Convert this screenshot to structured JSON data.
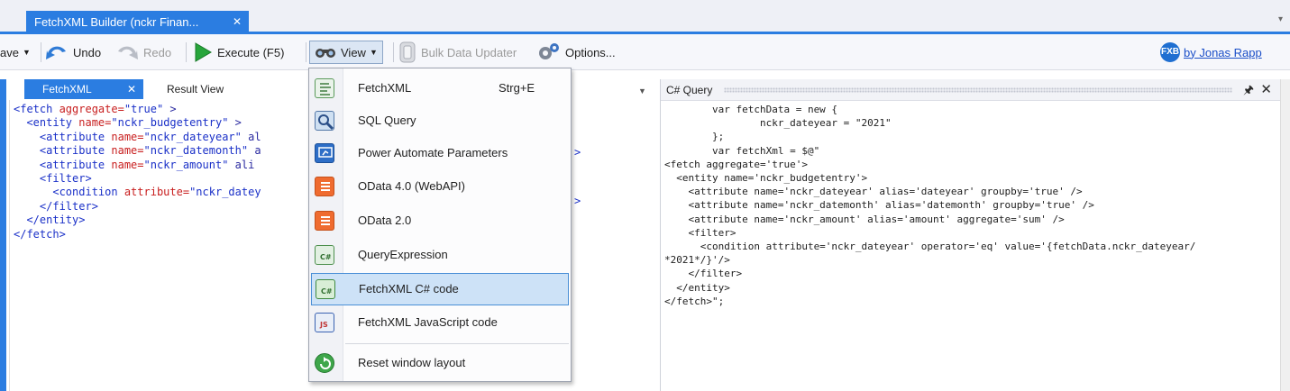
{
  "window": {
    "tab_title": "FetchXML Builder (nckr Finan...",
    "tab_close": "✕",
    "overflow_glyph": "▾"
  },
  "toolbar": {
    "save_label": "ave",
    "undo_label": "Undo",
    "redo_label": "Redo",
    "execute_label": "Execute (F5)",
    "view_label": "View",
    "bulk_label": "Bulk Data Updater",
    "options_label": "Options...",
    "author_badge": "FXB",
    "author_link": "by Jonas Rapp"
  },
  "left_tabs": [
    {
      "label": "FetchXML",
      "close": "✕"
    },
    {
      "label": "Result View"
    }
  ],
  "fetchxml_lines": [
    [
      "<fetch",
      " aggregate=",
      "\"true\"",
      " >"
    ],
    [
      "  <entity",
      " name=",
      "\"nckr_budgetentry\"",
      " >"
    ],
    [
      "    <attribute",
      " name=",
      "\"nckr_dateyear\"",
      " al"
    ],
    [
      "    <attribute",
      " name=",
      "\"nckr_datemonth\"",
      " a"
    ],
    [
      "    <attribute",
      " name=",
      "\"nckr_amount\"",
      " ali"
    ],
    [
      "    <filter>",
      "",
      "",
      ""
    ],
    [
      "      <condition",
      " attribute=",
      "\"nckr_datey",
      ""
    ],
    [
      "    </filter>",
      "",
      "",
      ""
    ],
    [
      "  </entity>",
      "",
      "",
      ""
    ],
    [
      "</fetch>",
      "",
      "",
      ""
    ]
  ],
  "fetchxml_overflow": [
    ">",
    ">"
  ],
  "csharp_panel": {
    "title": "C# Query",
    "pin": "ᛘ",
    "close": "✕",
    "code": "        var fetchData = new {\n                nckr_dateyear = \"2021\"\n        };\n        var fetchXml = $@\"\n<fetch aggregate='true'>\n  <entity name='nckr_budgetentry'>\n    <attribute name='nckr_dateyear' alias='dateyear' groupby='true' />\n    <attribute name='nckr_datemonth' alias='datemonth' groupby='true' />\n    <attribute name='nckr_amount' alias='amount' aggregate='sum' />\n    <filter>\n      <condition attribute='nckr_dateyear' operator='eq' value='{fetchData.nckr_dateyear/\n*2021*/}'/>\n    </filter>\n  </entity>\n</fetch>\";"
  },
  "view_menu": {
    "items": [
      {
        "label": "FetchXML",
        "shortcut": "Strg+E",
        "icon": "fetchxml-doc-icon"
      },
      {
        "label": "SQL Query",
        "icon": "sql-query-icon"
      },
      {
        "label": "Power Automate Parameters",
        "icon": "power-automate-icon"
      },
      {
        "label": "OData 4.0 (WebAPI)",
        "icon": "odata4-icon"
      },
      {
        "label": "OData 2.0",
        "icon": "odata2-icon"
      },
      {
        "label": "QueryExpression",
        "icon": "query-expression-icon"
      },
      {
        "label": "FetchXML C# code",
        "icon": "csharp-code-icon",
        "selected": true
      },
      {
        "label": "FetchXML JavaScript code",
        "icon": "javascript-code-icon"
      },
      {
        "label": "Reset window layout",
        "icon": "reset-layout-icon"
      }
    ],
    "icon_marks": {
      "cs": "C#",
      "js": "JS"
    }
  },
  "colors": {
    "accent": "#2b7de1",
    "menu_highlight": "#cde2f7",
    "xml_tag": "#1a30c8",
    "xml_attr": "#c81e1e"
  }
}
